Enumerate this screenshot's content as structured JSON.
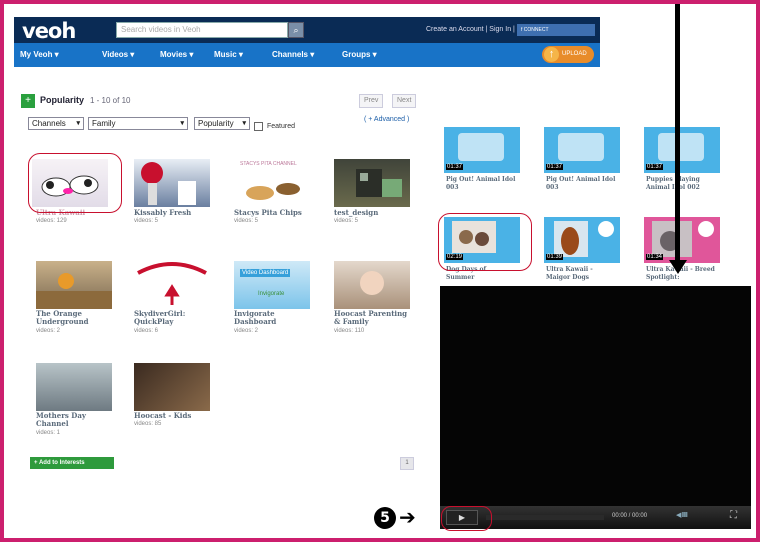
{
  "header": {
    "logo": "veoh",
    "search_placeholder": "Search videos in Veoh",
    "account_links": "Create an Account  |  Sign In  |",
    "facebook": "f CONNECT"
  },
  "nav": {
    "items": [
      "My Veoh ▾",
      "Videos ▾",
      "Movies ▾",
      "Music ▾",
      "Channels ▾",
      "Groups ▾"
    ],
    "upload": "UPLOAD"
  },
  "toolbar": {
    "title": "Popularity",
    "count": "1 - 10 of 10",
    "prev": "Prev",
    "next": "Next",
    "filter1": "Channels",
    "filter2": "Family",
    "sort": "Popularity",
    "featured": "Featured",
    "advanced": "( + Advanced )"
  },
  "channels": [
    {
      "title": "Ultra Kawaii",
      "count": "videos: 129"
    },
    {
      "title": "Kissably Fresh",
      "count": "videos: 5"
    },
    {
      "title": "Stacys Pita Chips",
      "count": "videos: 5"
    },
    {
      "title": "test_design",
      "count": "videos: 5"
    },
    {
      "title": "The Orange Underground",
      "count": "videos: 2"
    },
    {
      "title": "SkydiverGirl: QuickPlay",
      "count": "videos: 6"
    },
    {
      "title": "Invigorate Dashboard",
      "count": "videos: 2"
    },
    {
      "title": "Hoocast Parenting & Family",
      "count": "videos: 110"
    },
    {
      "title": "Mothers Day Channel",
      "count": "videos: 1"
    },
    {
      "title": "Hoocast - Kids",
      "count": "videos: 85"
    }
  ],
  "thumb_captions": {
    "stacys": "STACYS PITA CHANNEL",
    "invig_top": "Video Dashboard",
    "invig_bottom": "Invigorate"
  },
  "actions": {
    "add_interests": "+ Add to Interests",
    "page": "1"
  },
  "videos": [
    {
      "title": "Pig Out! Animal Idol 003",
      "duration": "01:37"
    },
    {
      "title": "Pig Out! Animal Idol 003",
      "duration": "01:37"
    },
    {
      "title": "Puppies Playing Animal Idol 002",
      "duration": "01:37"
    },
    {
      "title": "Dog Days of Summer",
      "duration": "02:19"
    },
    {
      "title": "Ultra Kawaii - Maigor Dogs",
      "duration": "01:39"
    },
    {
      "title": "Ultra Kawaii - Breed Spotlight:",
      "duration": "01:34"
    }
  ],
  "player": {
    "play": "▶",
    "time": "00:00 / 00:00",
    "volume": "◀ IIIIII",
    "fullscreen": "⛶"
  },
  "annotation": {
    "step": "5",
    "arrow": "➔"
  }
}
